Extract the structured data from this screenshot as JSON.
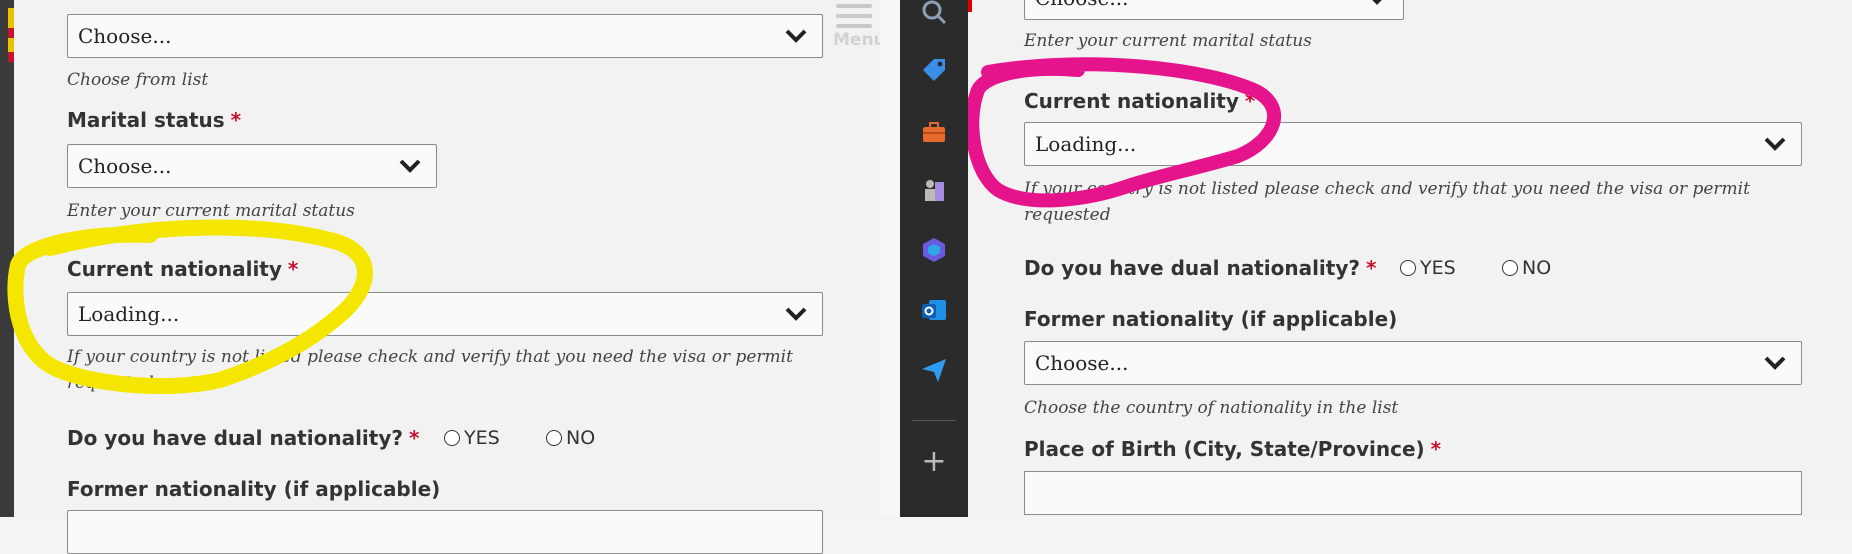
{
  "left": {
    "top_select": {
      "value": "Choose...",
      "help": "Choose from list"
    },
    "marital": {
      "label": "Marital status",
      "required": "*",
      "value": "Choose...",
      "help": "Enter your current marital status"
    },
    "nationality": {
      "label": "Current nationality",
      "required": "*",
      "value": "Loading...",
      "help": "If your country is not listed please check and verify that you need the visa or permit requested"
    },
    "dual": {
      "label": "Do you have dual nationality?",
      "required": "*",
      "yes": "YES",
      "no": "NO"
    },
    "former": {
      "label": "Former nationality (if applicable)"
    },
    "menu_label": "Menu",
    "highlight_color": "#f5e600"
  },
  "sidebar": {
    "icons": [
      "search-icon",
      "tag-icon",
      "briefcase-icon",
      "chess-icon",
      "copilot-icon",
      "outlook-icon",
      "send-icon",
      "add-icon"
    ],
    "add_symbol": "+"
  },
  "right": {
    "marital_help": "Enter your current marital status",
    "top_select_value": "Choose...",
    "nationality": {
      "label": "Current nationality",
      "required": "*",
      "value": "Loading...",
      "help": "If your country is not listed please check and verify that you need the visa or permit requested"
    },
    "dual": {
      "label": "Do you have dual nationality?",
      "required": "*",
      "yes": "YES",
      "no": "NO"
    },
    "former": {
      "label": "Former nationality (if applicable)",
      "value": "Choose...",
      "help": "Choose the country of nationality in the list"
    },
    "birth": {
      "label": "Place of Birth (City, State/Province)",
      "required": "*",
      "value": ""
    },
    "highlight_color": "#e6148c"
  }
}
